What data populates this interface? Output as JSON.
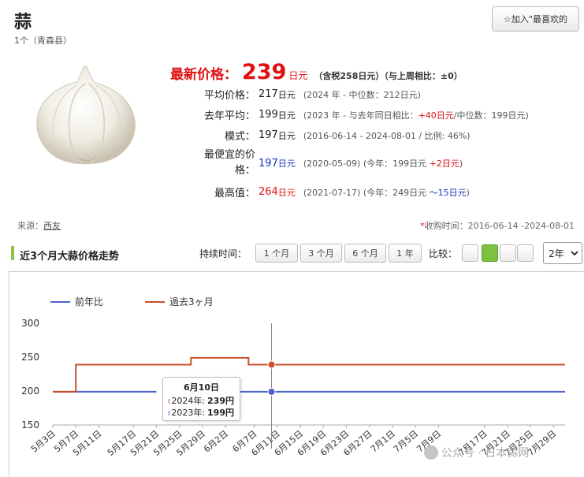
{
  "product": {
    "title": "蒜",
    "subtitle": "1个（青森县）",
    "favorite_label": "☆加入\"最喜欢的"
  },
  "price": {
    "label": "最新价格：",
    "value": "239",
    "unit": "日元",
    "note": "（含税258日元）（与上周相比：±0）"
  },
  "stats": [
    {
      "label": "平均价格：",
      "value": "217",
      "unit": "日元",
      "detail": "(2024 年 - 中位数：212日元)"
    },
    {
      "label": "去年平均：",
      "value": "199",
      "unit": "日元",
      "detail_pre": "(2023 年 - 与去年同日相比：",
      "detail_red": "+40日元",
      "detail_post": "/中位数：199日元)"
    },
    {
      "label": "模式：",
      "value": "197",
      "unit": "日元",
      "detail": "(2016-06-14 - 2024-08-01 / 比例: 46%)"
    },
    {
      "label_line1": "最便宜的价",
      "label_line2": "格：",
      "value": "197",
      "unit": "日元",
      "detail_pre": "(2020-05-09) (今年：199日元 ",
      "detail_red": "+2日元",
      "detail_post": ")"
    },
    {
      "label": "最高值：",
      "value": "264",
      "unit": "日元",
      "detail_pre": "(2021-07-17) (今年：249日元 ",
      "detail_blue": "～15日元",
      "detail_post": ")"
    }
  ],
  "source": {
    "label": "来源：",
    "link": "西友"
  },
  "collection": {
    "asterisk": "*",
    "text": "收购时间：2016-06-14 -2024-08-01"
  },
  "section": {
    "title": "近3个月大蒜价格走势",
    "duration_label": "持续时间：",
    "durations": [
      "1 个月",
      "3 个月",
      "6 个月",
      "1 年"
    ],
    "compare_label": "比较：",
    "year_select": "2年"
  },
  "colors": {
    "last_year": "#4a63c8",
    "past_3_months": "#c8502a",
    "accent_green": "#8bc34a",
    "price_red": "#e01010"
  },
  "chart_data": {
    "type": "line",
    "legend": [
      "前年比",
      "過去3ヶ月"
    ],
    "legend_position": "top-left",
    "ylim": [
      150,
      300
    ],
    "yticks": [
      300,
      250,
      200,
      150
    ],
    "x_tick_labels": [
      "5月3日",
      "5月7日",
      "5月11日",
      "5月17日",
      "5月21日",
      "5月25日",
      "5月29日",
      "6月2日",
      "6月7日",
      "6月11日",
      "6月15日",
      "6月19日",
      "6月23日",
      "6月27日",
      "7月1日",
      "7月5日",
      "7月9日",
      "7月17日",
      "7月21日",
      "7月25日",
      "7月29日"
    ],
    "series": [
      {
        "name": "前年比",
        "points": [
          [
            "5月3日",
            199
          ],
          [
            "6月10日",
            199
          ],
          [
            "7月31日",
            199
          ]
        ],
        "gap": [
          "5月21日",
          "5月25日"
        ]
      },
      {
        "name": "過去3ヶ月",
        "points": [
          [
            "5月3日",
            199
          ],
          [
            "5月5日",
            199
          ],
          [
            "5月7日",
            239
          ],
          [
            "5月25日",
            239
          ],
          [
            "5月27日",
            249
          ],
          [
            "6月4日",
            249
          ],
          [
            "6月6日",
            239
          ],
          [
            "6月10日",
            239
          ],
          [
            "7月31日",
            239
          ]
        ]
      }
    ],
    "grid": false,
    "crosshair": "6月10日"
  },
  "tooltip": {
    "date": "6月10日",
    "rows": [
      {
        "label": "2024年: ",
        "value": "239円"
      },
      {
        "label": "2023年: ",
        "value": "199円"
      }
    ]
  },
  "watermark": {
    "text": "公众号 · 日本蒜网"
  }
}
